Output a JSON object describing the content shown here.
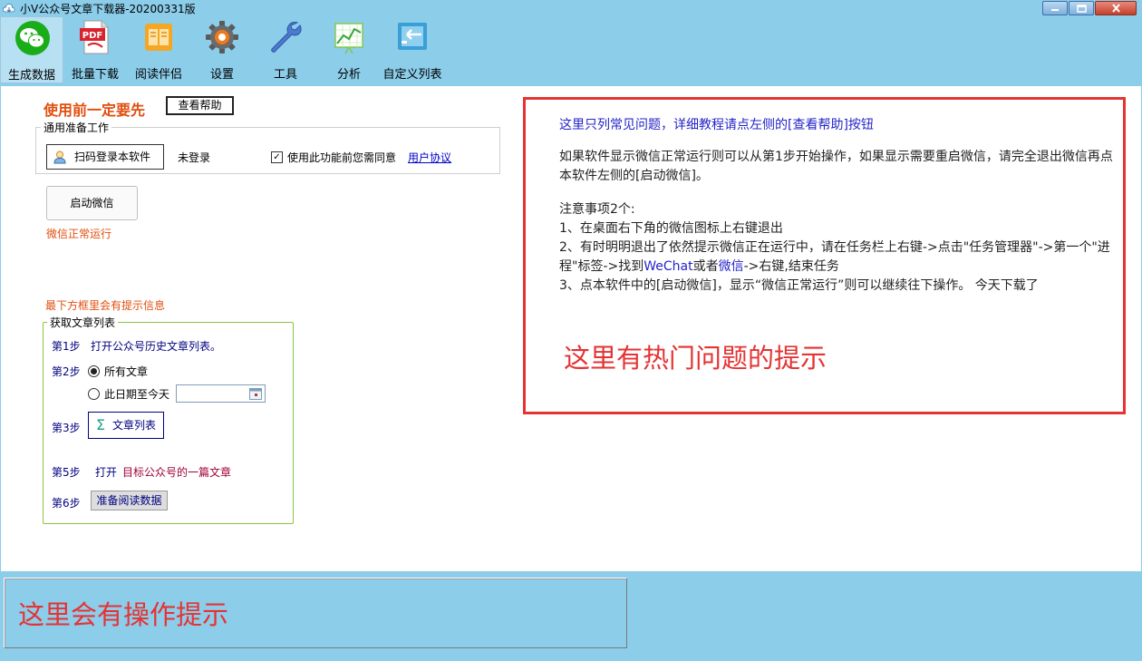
{
  "window": {
    "title": "小V公众号文章下载器-20200331版",
    "buttons": [
      "minimize-icon",
      "maximize-icon",
      "close-icon"
    ]
  },
  "toolbar": {
    "items": [
      {
        "label": "生成数据",
        "icon": "wechat-icon",
        "active": true
      },
      {
        "label": "批量下载",
        "icon": "pdf-icon"
      },
      {
        "label": "阅读伴侣",
        "icon": "books-icon"
      },
      {
        "label": "设置",
        "icon": "gear-icon"
      },
      {
        "label": "工具",
        "icon": "wrench-icon"
      },
      {
        "label": "分析",
        "icon": "chart-icon"
      },
      {
        "label": "自定义列表",
        "icon": "custom-list-icon"
      }
    ]
  },
  "left": {
    "warning_title": "使用前一定要先",
    "help_button": "查看帮助",
    "prep_group_title": "通用准备工作",
    "scan_login_button": "扫码登录本软件",
    "login_status": "未登录",
    "agree_text": "使用此功能前您需同意",
    "agree_checked": true,
    "user_agreement_link": "用户协议",
    "start_wechat_button": "启动微信",
    "wechat_status": "微信正常运行",
    "bottom_hint": "最下方框里会有提示信息",
    "fetch_group_title": "获取文章列表",
    "step1_label": "第1步",
    "step1_text": "打开公众号历史文章列表。",
    "step2_label": "第2步",
    "radio_all": "所有文章",
    "radio_all_selected": true,
    "radio_date": "此日期至今天",
    "date_value": "",
    "step3_label": "第3步",
    "article_list_button": "文章列表",
    "step5_label": "第5步",
    "step5_open": "打开",
    "step5_text": "目标公众号的一篇文章",
    "step6_label": "第6步",
    "prepare_read_button": "准备阅读数据"
  },
  "info": {
    "heading": "这里只列常见问题，详细教程请点左侧的[查看帮助]按钮",
    "para1": "如果软件显示微信正常运行则可以从第1步开始操作，如果显示需要重启微信，请完全退出微信再点本软件左侧的[启动微信]。",
    "notes_title": "注意事项2个:",
    "note1": "1、在桌面右下角的微信图标上右键退出",
    "note2_a": "2、有时明明退出了依然提示微信正在运行中，请在任务栏上右键->点击\"任务管理器\"->第一个\"进程\"标签->找到",
    "note2_wechat": "WeChat",
    "note2_or": "或者",
    "note2_weixin": "微信",
    "note2_b": "->右键,结束任务",
    "note3": "3、点本软件中的[启动微信]，显示“微信正常运行”则可以继续往下操作。 今天下载了",
    "hot_tip": "这里有热门问题的提示"
  },
  "bottom": {
    "status_text": "这里会有操作提示"
  }
}
